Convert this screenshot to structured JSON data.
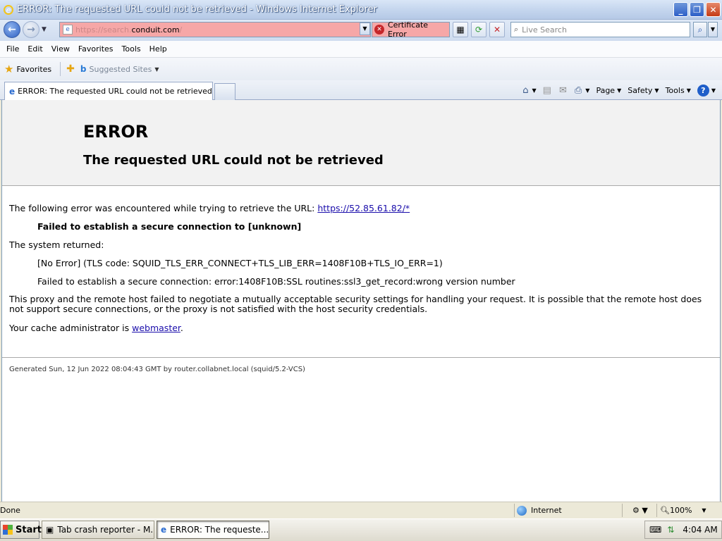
{
  "window": {
    "title": "ERROR: The requested URL could not be retrieved - Windows Internet Explorer",
    "minimize": "_",
    "maximize": "❐",
    "close": "✕"
  },
  "navigation": {
    "url_prefix": "https://search.",
    "url_host": "conduit.com",
    "url_suffix": "/",
    "certificate_error": "Certificate Error",
    "search_placeholder": "Live Search"
  },
  "menu": [
    "File",
    "Edit",
    "View",
    "Favorites",
    "Tools",
    "Help"
  ],
  "favorites_bar": {
    "favorites_label": "Favorites",
    "suggested_sites": "Suggested Sites"
  },
  "tab": {
    "title": "ERROR: The requested URL could not be retrieved"
  },
  "command_bar": {
    "page": "Page",
    "safety": "Safety",
    "tools": "Tools",
    "help": "?"
  },
  "content": {
    "heading": "ERROR",
    "subheading": "The requested URL could not be retrieved",
    "intro": "The following error was encountered while trying to retrieve the URL: ",
    "intro_link": "https://52.85.61.82/*",
    "failed_bold": "Failed to establish a secure connection to [unknown]",
    "system_returned": "The system returned:",
    "no_error": "[No Error] (TLS code: SQUID_TLS_ERR_CONNECT+TLS_LIB_ERR=1408F10B+TLS_IO_ERR=1)",
    "ssl_error": "Failed to establish a secure connection: error:1408F10B:SSL routines:ssl3_get_record:wrong version number",
    "explanation": "This proxy and the remote host failed to negotiate a mutually acceptable security settings for handling your request. It is possible that the remote host does not support secure connections, or the proxy is not satisfied with the host security credentials.",
    "admin_prefix": "Your cache administrator is ",
    "admin_link": "webmaster",
    "admin_suffix": ".",
    "footer": "Generated Sun, 12 Jun 2022 08:04:43 GMT by router.collabnet.local (squid/5.2-VCS)"
  },
  "status": {
    "done": "Done",
    "zone": "Internet",
    "zoom": "100%"
  },
  "taskbar": {
    "start": "Start",
    "task1": "Tab crash reporter - M...",
    "task2": "ERROR: The requeste...",
    "clock": "4:04 AM"
  }
}
